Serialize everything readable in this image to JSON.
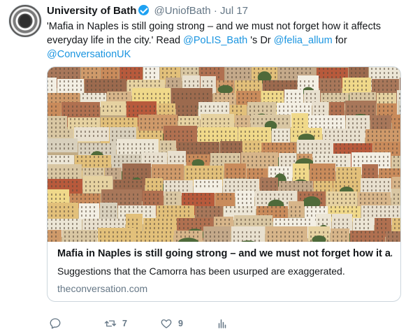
{
  "tweet": {
    "author_name": "University of Bath",
    "handle": "@UniofBath",
    "separator": "·",
    "date": "Jul 17",
    "text_1": "'Mafia in Naples is still going strong – and we must not forget how it affects everyday life in the city.' Read ",
    "mention_1": "@PoLIS_Bath",
    "text_2": " 's Dr ",
    "mention_2": "@felia_allum",
    "text_3": " for ",
    "mention_3": "@ConversationUK"
  },
  "card": {
    "title": "Mafia in Naples is still going strong – and we must not forget how it a...",
    "description": "Suggestions that the Camorra has been usurped are exaggerated.",
    "domain": "theconversation.com"
  },
  "actions": {
    "reply_icon": "reply-icon",
    "retweet_icon": "retweet-icon",
    "retweet_count": "7",
    "like_icon": "heart-icon",
    "like_count": "9",
    "analytics_icon": "analytics-icon"
  },
  "colors": {
    "link": "#1b95e0",
    "secondary_text": "#657786",
    "verified": "#1da1f2",
    "border": "#ccd6dd"
  }
}
